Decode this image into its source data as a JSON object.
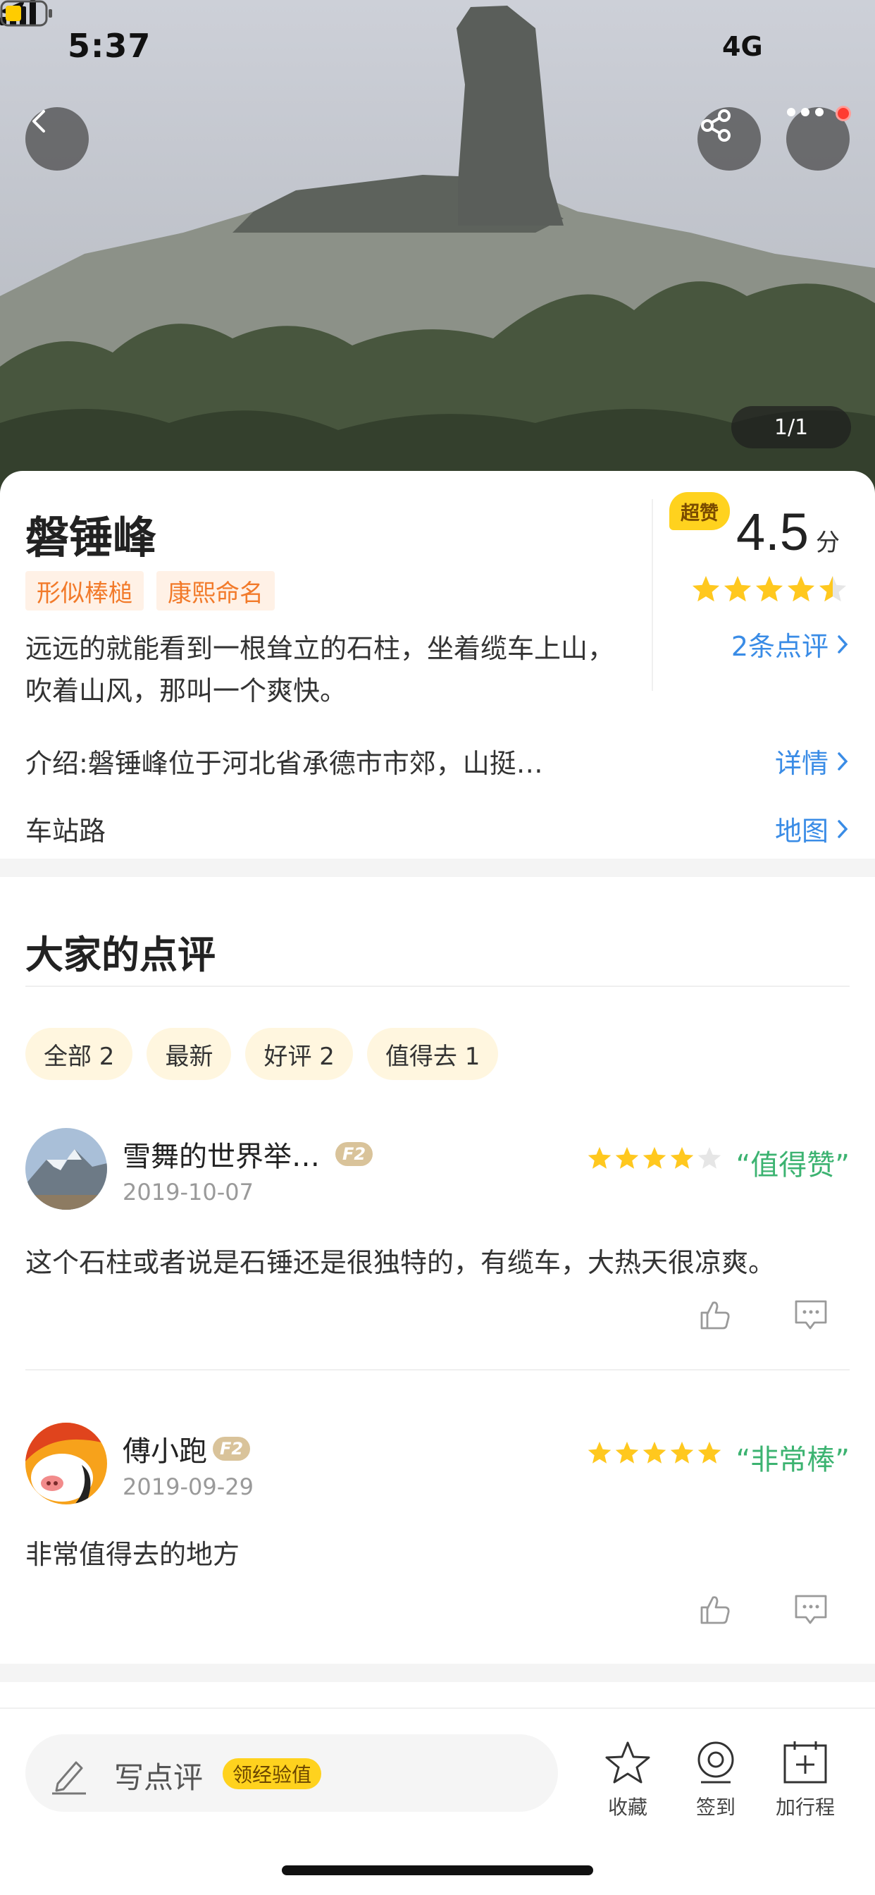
{
  "status_bar": {
    "time": "5:37",
    "network": "4G"
  },
  "hero": {
    "photo_counter": "1/1"
  },
  "attraction": {
    "name": "磐锤峰",
    "tags": [
      "形似棒槌",
      "康熙命名"
    ],
    "summary": "远远的就能看到一根耸立的石柱，坐着缆车上山，吹着山风，那叫一个爽快。",
    "badge": "超赞",
    "score": "4.5",
    "score_unit": "分",
    "rating_stars": 4.5,
    "reviews_link": "2条点评",
    "intro": "介绍:磐锤峰位于河北省承德市市郊，山挺…",
    "detail_link": "详情",
    "address": "车站路",
    "map_link": "地图"
  },
  "reviews_section": {
    "title": "大家的点评",
    "filters": [
      "全部 2",
      "最新",
      "好评 2",
      "值得去 1"
    ],
    "reviews": [
      {
        "user": "雪舞的世界举…",
        "level": "F2",
        "date": "2019-10-07",
        "stars": 4,
        "quote": "“值得赞”",
        "text": "这个石柱或者说是石锤还是很独特的，有缆车，大热天很凉爽。"
      },
      {
        "user": "傅小跑",
        "level": "F2",
        "date": "2019-09-29",
        "stars": 5,
        "quote": "“非常棒”",
        "text": "非常值得去的地方"
      }
    ]
  },
  "bottom_bar": {
    "write_review": "写点评",
    "xp_badge": "领经验值",
    "favorite": "收藏",
    "checkin": "签到",
    "add_itinerary": "加行程"
  },
  "colors": {
    "accent_blue": "#3a8ce6",
    "star_yellow": "#ffc81e",
    "tag_orange": "#f27a2a",
    "quote_green": "#3cb371",
    "badge_yellow": "#ffd21e"
  }
}
